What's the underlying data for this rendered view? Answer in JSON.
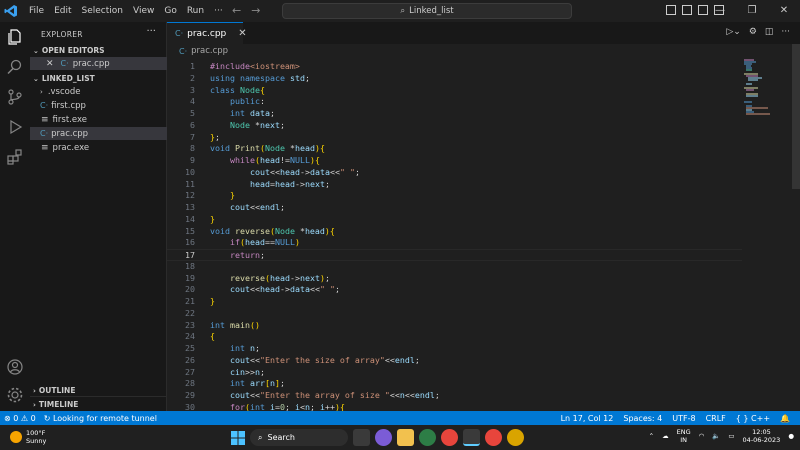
{
  "titlebar": {
    "menu": [
      "File",
      "Edit",
      "Selection",
      "View",
      "Go",
      "Run",
      "···"
    ],
    "search_text": "Linked_list"
  },
  "sidebar": {
    "title": "EXPLORER",
    "open_editors_label": "OPEN EDITORS",
    "open_editor_file": "prac.cpp",
    "folder_label": "LINKED_LIST",
    "tree": [
      {
        "name": ".vscode",
        "type": "folder"
      },
      {
        "name": "first.cpp",
        "type": "cpp"
      },
      {
        "name": "first.exe",
        "type": "exe"
      },
      {
        "name": "prac.cpp",
        "type": "cpp",
        "active": true
      },
      {
        "name": "prac.exe",
        "type": "exe"
      }
    ],
    "outline_label": "OUTLINE",
    "timeline_label": "TIMELINE"
  },
  "editor": {
    "tab_label": "prac.cpp",
    "breadcrumb": "prac.cpp",
    "current_line": 17,
    "lines": [
      "#include<iostream>",
      "using namespace std;",
      "class Node{",
      "    public:",
      "    int data;",
      "    Node *next;",
      "};",
      "void Print(Node *head){",
      "    while(head!=NULL){",
      "        cout<<head->data<<\" \";",
      "        head=head->next;",
      "    }",
      "    cout<<endl;",
      "}",
      "void reverse(Node *head){",
      "    if(head==NULL)",
      "    return;",
      "",
      "    reverse(head->next);",
      "    cout<<head->data<<\" \";",
      "}",
      "",
      "int main()",
      "{",
      "    int n;",
      "    cout<<\"Enter the size of array\"<<endl;",
      "    cin>>n;",
      "    int arr[n];",
      "    cout<<\"Enter the array of size \"<<n<<endl;",
      "    for(int i=0; i<n; i++){"
    ]
  },
  "statusbar": {
    "problems": "⊗ 0 ⚠ 0",
    "remote": "Looking for remote tunnel",
    "position": "Ln 17, Col 12",
    "spaces": "Spaces: 4",
    "encoding": "UTF-8",
    "eol": "CRLF",
    "language": "{ } C++"
  },
  "taskbar": {
    "temp": "100°F",
    "weather": "Sunny",
    "search": "Search",
    "lang1": "ENG",
    "lang2": "IN",
    "time": "12:05",
    "date": "04-06-2023"
  },
  "colors": {
    "accent": "#0078d4",
    "statusbar": "#0078d4",
    "background": "#1f1f1f"
  }
}
